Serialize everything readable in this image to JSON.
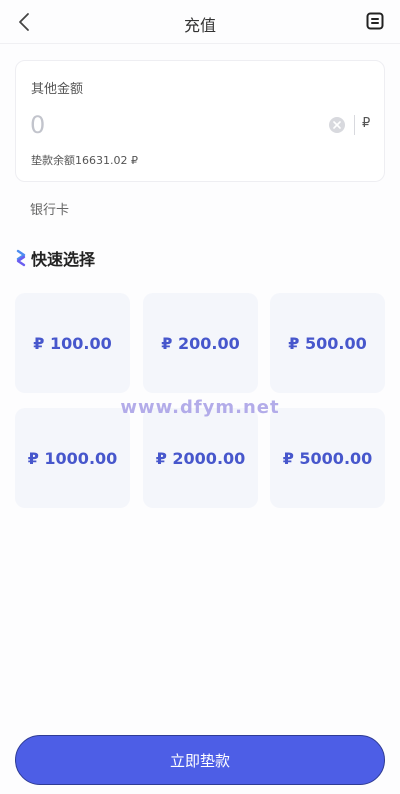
{
  "header": {
    "title": "充值",
    "back_icon": "chevron-left-icon",
    "record_icon": "record-icon"
  },
  "amount": {
    "label": "其他金额",
    "placeholder": "0",
    "currency": "₽",
    "balance": "垫款余额16631.02 ₽"
  },
  "payment_method": "银行卡",
  "quick_select": {
    "title": "快速选择",
    "options": [
      "₽ 100.00",
      "₽ 200.00",
      "₽ 500.00",
      "₽ 1000.00",
      "₽ 2000.00",
      "₽ 5000.00"
    ]
  },
  "watermark": "www.dfym.net",
  "submit_label": "立即垫款",
  "colors": {
    "accent": "#4d5ee6",
    "option_text": "#4757cc",
    "option_bg": "#f4f6fb"
  }
}
